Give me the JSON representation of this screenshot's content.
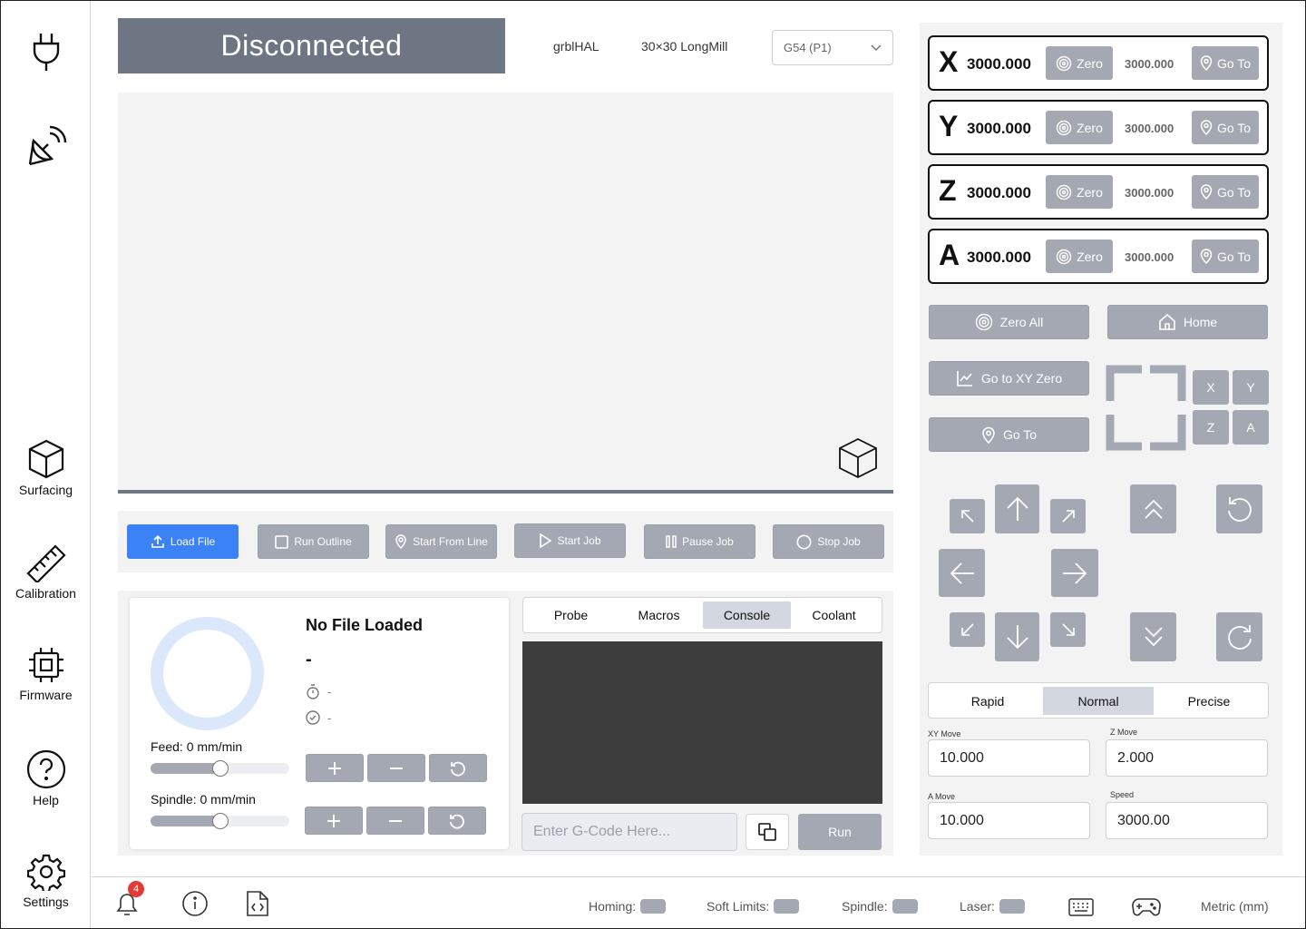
{
  "sidebar": {
    "items": [
      {
        "label": ""
      },
      {
        "label": ""
      },
      {
        "label": "Surfacing"
      },
      {
        "label": "Calibration"
      },
      {
        "label": "Firmware"
      },
      {
        "label": "Help"
      },
      {
        "label": "Settings"
      }
    ]
  },
  "header": {
    "status": "Disconnected",
    "firmware": "grblHAL",
    "machine": "30×30 LongMill",
    "workspace": "G54 (P1)"
  },
  "job_controls": {
    "load_file": "Load File",
    "run_outline": "Run Outline",
    "start_from_line": "Start From Line",
    "start_job": "Start Job",
    "pause_job": "Pause Job",
    "stop_job": "Stop Job"
  },
  "file_info": {
    "title": "No File Loaded",
    "name": "-",
    "time": "-",
    "completed": "-",
    "feed_label": "Feed: 0 mm/min",
    "spindle_label": "Spindle: 0 mm/min",
    "feed_override": 0.5,
    "spindle_override": 0.5
  },
  "tools_tabs": [
    "Probe",
    "Macros",
    "Console",
    "Coolant"
  ],
  "active_tool_tab": "Console",
  "console": {
    "placeholder": "Enter G-Code Here...",
    "run_label": "Run"
  },
  "dro": {
    "axes": [
      {
        "axis": "X",
        "work_pos": "3000.000",
        "machine_pos": "3000.000",
        "zero_label": "Zero",
        "goto_label": "Go To"
      },
      {
        "axis": "Y",
        "work_pos": "3000.000",
        "machine_pos": "3000.000",
        "zero_label": "Zero",
        "goto_label": "Go To"
      },
      {
        "axis": "Z",
        "work_pos": "3000.000",
        "machine_pos": "3000.000",
        "zero_label": "Zero",
        "goto_label": "Go To"
      },
      {
        "axis": "A",
        "work_pos": "3000.000",
        "machine_pos": "3000.000",
        "zero_label": "Zero",
        "goto_label": "Go To"
      }
    ],
    "zero_all": "Zero All",
    "home": "Home",
    "go_to_xy_zero": "Go to XY Zero",
    "go_to": "Go To",
    "home_axes": [
      "X",
      "Y",
      "Z",
      "A"
    ]
  },
  "jog": {
    "modes": [
      "Rapid",
      "Normal",
      "Precise"
    ],
    "active_mode": "Normal",
    "xy_move_label": "XY Move",
    "xy_move": "10.000",
    "z_move_label": "Z Move",
    "z_move": "2.000",
    "a_move_label": "A Move",
    "a_move": "10.000",
    "speed_label": "Speed",
    "speed": "3000.00"
  },
  "footer": {
    "notifications": "4",
    "homing": "Homing:",
    "soft_limits": "Soft Limits:",
    "spindle": "Spindle:",
    "laser": "Laser:",
    "units": "Metric (mm)"
  },
  "colors": {
    "accent": "#3b82f6",
    "button": "#a3a8b2",
    "status_banner": "#6f7683",
    "console_bg": "#3d3d3d",
    "badge": "#e53935"
  }
}
